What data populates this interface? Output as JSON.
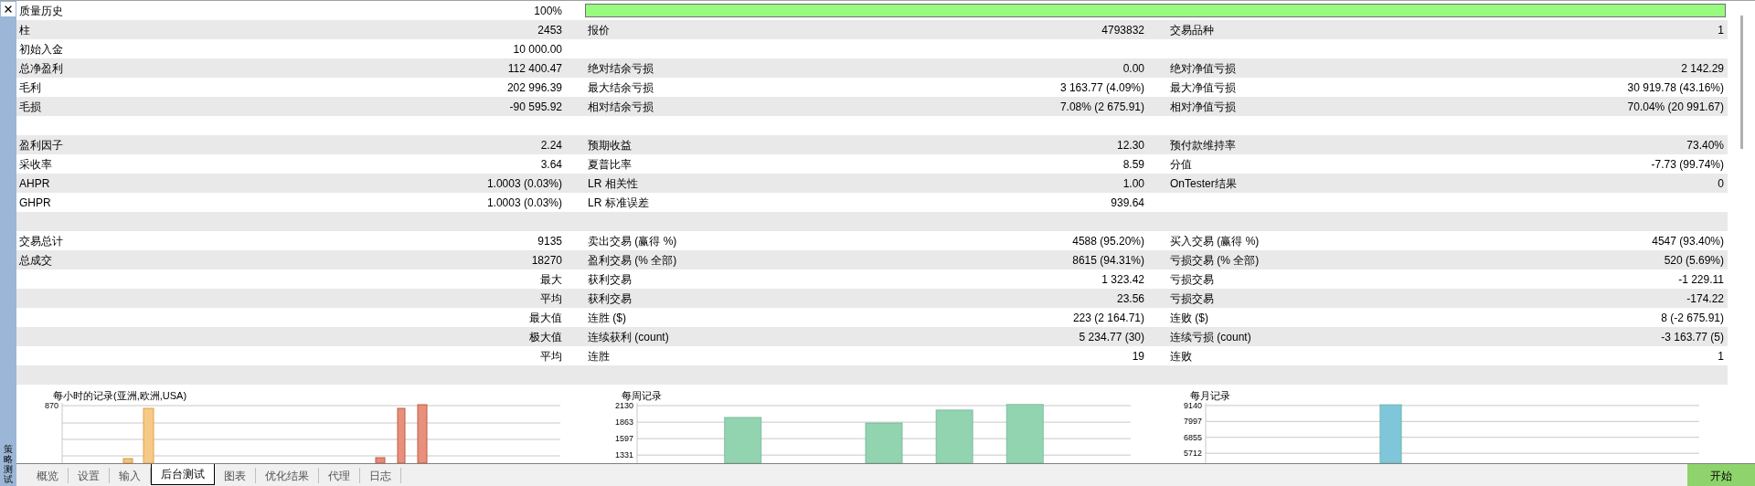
{
  "side_panel": {
    "title": "策略测试"
  },
  "stats": {
    "rows": [
      {
        "kind": "progress",
        "cells": [
          {
            "label": "质量历史",
            "value": "100%"
          }
        ],
        "level": 1
      },
      {
        "kind": "stats",
        "cells": [
          {
            "label": "柱",
            "value": "2453"
          },
          {
            "label": "报价",
            "value": "4793832"
          },
          {
            "label": "交易品种",
            "value": "1"
          }
        ]
      },
      {
        "kind": "stats",
        "cells": [
          {
            "label": "初始入金",
            "value": "10 000.00"
          }
        ]
      },
      {
        "kind": "stats",
        "cells": [
          {
            "label": "总净盈利",
            "value": "112 400.47"
          },
          {
            "label": "绝对结余亏损",
            "value": "0.00"
          },
          {
            "label": "绝对净值亏损",
            "value": "2 142.29"
          }
        ]
      },
      {
        "kind": "stats",
        "cells": [
          {
            "label": "毛利",
            "value": "202 996.39"
          },
          {
            "label": "最大结余亏损",
            "value": "3 163.77 (4.09%)"
          },
          {
            "label": "最大净值亏损",
            "value": "30 919.78 (43.16%)"
          }
        ]
      },
      {
        "kind": "stats",
        "cells": [
          {
            "label": "毛损",
            "value": "-90 595.92"
          },
          {
            "label": "相对结余亏损",
            "value": "7.08% (2 675.91)"
          },
          {
            "label": "相对净值亏损",
            "value": "70.04% (20 991.67)"
          }
        ]
      },
      {
        "kind": "blank"
      },
      {
        "kind": "stats",
        "cells": [
          {
            "label": "盈利因子",
            "value": "2.24"
          },
          {
            "label": "预期收益",
            "value": "12.30"
          },
          {
            "label": "预付款维持率",
            "value": "73.40%"
          }
        ]
      },
      {
        "kind": "stats",
        "cells": [
          {
            "label": "采收率",
            "value": "3.64"
          },
          {
            "label": "夏普比率",
            "value": "8.59"
          },
          {
            "label": "分值",
            "value": "-7.73 (99.74%)"
          }
        ]
      },
      {
        "kind": "stats",
        "cells": [
          {
            "label": "AHPR",
            "value": "1.0003 (0.03%)"
          },
          {
            "label": "LR 相关性",
            "value": "1.00"
          },
          {
            "label": "OnTester结果",
            "value": "0"
          }
        ]
      },
      {
        "kind": "stats",
        "cells": [
          {
            "label": "GHPR",
            "value": "1.0003 (0.03%)"
          },
          {
            "label": "LR 标准误差",
            "value": "939.64"
          }
        ]
      },
      {
        "kind": "blank"
      },
      {
        "kind": "stats",
        "cells": [
          {
            "label": "交易总计",
            "value": "9135"
          },
          {
            "label": "卖出交易 (赢得 %)",
            "value": "4588 (95.20%)"
          },
          {
            "label": "买入交易 (赢得 %)",
            "value": "4547 (93.40%)"
          }
        ]
      },
      {
        "kind": "stats",
        "cells": [
          {
            "label": "总成交",
            "value": "18270"
          },
          {
            "label": "盈利交易 (% 全部)",
            "value": "8615 (94.31%)"
          },
          {
            "label": "亏损交易 (% 全部)",
            "value": "520 (5.69%)"
          }
        ]
      },
      {
        "kind": "stats",
        "cells": [
          {
            "value": "最大"
          },
          {
            "label": "获利交易",
            "value": "1 323.42"
          },
          {
            "label": "亏损交易",
            "value": "-1 229.11"
          }
        ]
      },
      {
        "kind": "stats",
        "cells": [
          {
            "value": "平均"
          },
          {
            "label": "获利交易",
            "value": "23.56"
          },
          {
            "label": "亏损交易",
            "value": "-174.22"
          }
        ]
      },
      {
        "kind": "stats",
        "cells": [
          {
            "value": "最大值"
          },
          {
            "label": "连胜 ($)",
            "value": "223 (2 164.71)"
          },
          {
            "label": "连败 ($)",
            "value": "8 (-2 675.91)"
          }
        ]
      },
      {
        "kind": "stats",
        "cells": [
          {
            "value": "极大值"
          },
          {
            "label": "连续获利 (count)",
            "value": "5 234.77 (30)"
          },
          {
            "label": "连续亏损 (count)",
            "value": "-3 163.77 (5)"
          }
        ]
      },
      {
        "kind": "stats",
        "cells": [
          {
            "value": "平均"
          },
          {
            "label": "连胜",
            "value": "19"
          },
          {
            "label": "连败",
            "value": "1"
          }
        ]
      },
      {
        "kind": "blank"
      }
    ]
  },
  "charts": [
    {
      "kind": "picture",
      "title": "每小时的记录(亚洲,欧洲,USA)",
      "tick_labels": [
        "870"
      ]
    },
    {
      "kind": "bar",
      "chart_data": {
        "type": "bar",
        "title": "每周记录",
        "categories": [
          null,
          null,
          null,
          null,
          null,
          null,
          null
        ],
        "grid": true,
        "ylim": [
          1200,
          2175
        ],
        "yticks": [
          1331,
          1597,
          1863,
          2130
        ],
        "series": [
          {
            "color": "#93d4b0",
            "values": [
              null,
              1940,
              null,
              1850,
              2060,
              2150,
              null
            ]
          }
        ]
      }
    },
    {
      "kind": "bar",
      "chart_data": {
        "type": "bar",
        "title": "每月记录",
        "categories": [
          null,
          null,
          null,
          null,
          null,
          null,
          null,
          null,
          null,
          null,
          null,
          null
        ],
        "grid": true,
        "ylim": [
          5000,
          9330
        ],
        "yticks": [
          5712,
          6855,
          7997,
          9140
        ],
        "series": [
          {
            "color": "#7fc6da",
            "values": [
              null,
              null,
              null,
              null,
              9200,
              null,
              null,
              null,
              null,
              null,
              null,
              null
            ]
          }
        ]
      }
    }
  ],
  "tabs": [
    {
      "label": "概览",
      "selected": false
    },
    {
      "label": "设置",
      "selected": false
    },
    {
      "label": "输入",
      "selected": false
    },
    {
      "label": "后台测试",
      "selected": true
    },
    {
      "label": "图表",
      "selected": false
    },
    {
      "label": "优化结果",
      "selected": false
    },
    {
      "label": "代理",
      "selected": false
    },
    {
      "label": "日志",
      "selected": false
    }
  ],
  "start_button": {
    "label": "开始"
  }
}
